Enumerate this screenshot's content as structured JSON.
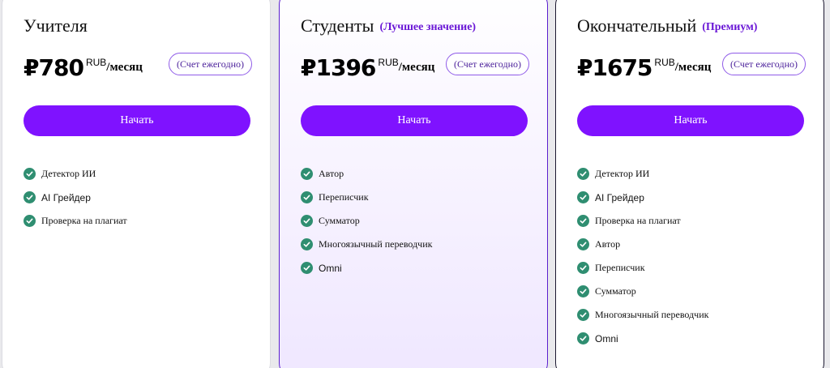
{
  "colors": {
    "accent": "#7f12ff",
    "badge_text": "#6a17d6",
    "check": "#2f8e71"
  },
  "plans": [
    {
      "title": "Учителя",
      "badge": "",
      "price": "₽780",
      "currency": "RUB",
      "period": "/месяц",
      "billing": "(Счет ежегодно)",
      "cta": "Начать",
      "features": [
        "Детектор ИИ",
        "AI Грейдер",
        "Проверка на плагиат"
      ]
    },
    {
      "title": "Студенты",
      "badge": "(Лучшее значение)",
      "price": "₽1396",
      "currency": "RUB",
      "period": "/месяц",
      "billing": "(Счет ежегодно)",
      "cta": "Начать",
      "features": [
        "Автор",
        "Переписчик",
        "Сумматор",
        "Многоязычный переводчик",
        "Omni"
      ]
    },
    {
      "title": "Окончательный",
      "badge": "(Премиум)",
      "price": "₽1675",
      "currency": "RUB",
      "period": "/месяц",
      "billing": "(Счет ежегодно)",
      "cta": "Начать",
      "features": [
        "Детектор ИИ",
        "AI Грейдер",
        "Проверка на плагиат",
        "Автор",
        "Переписчик",
        "Сумматор",
        "Многоязычный переводчик",
        "Omni"
      ]
    }
  ]
}
